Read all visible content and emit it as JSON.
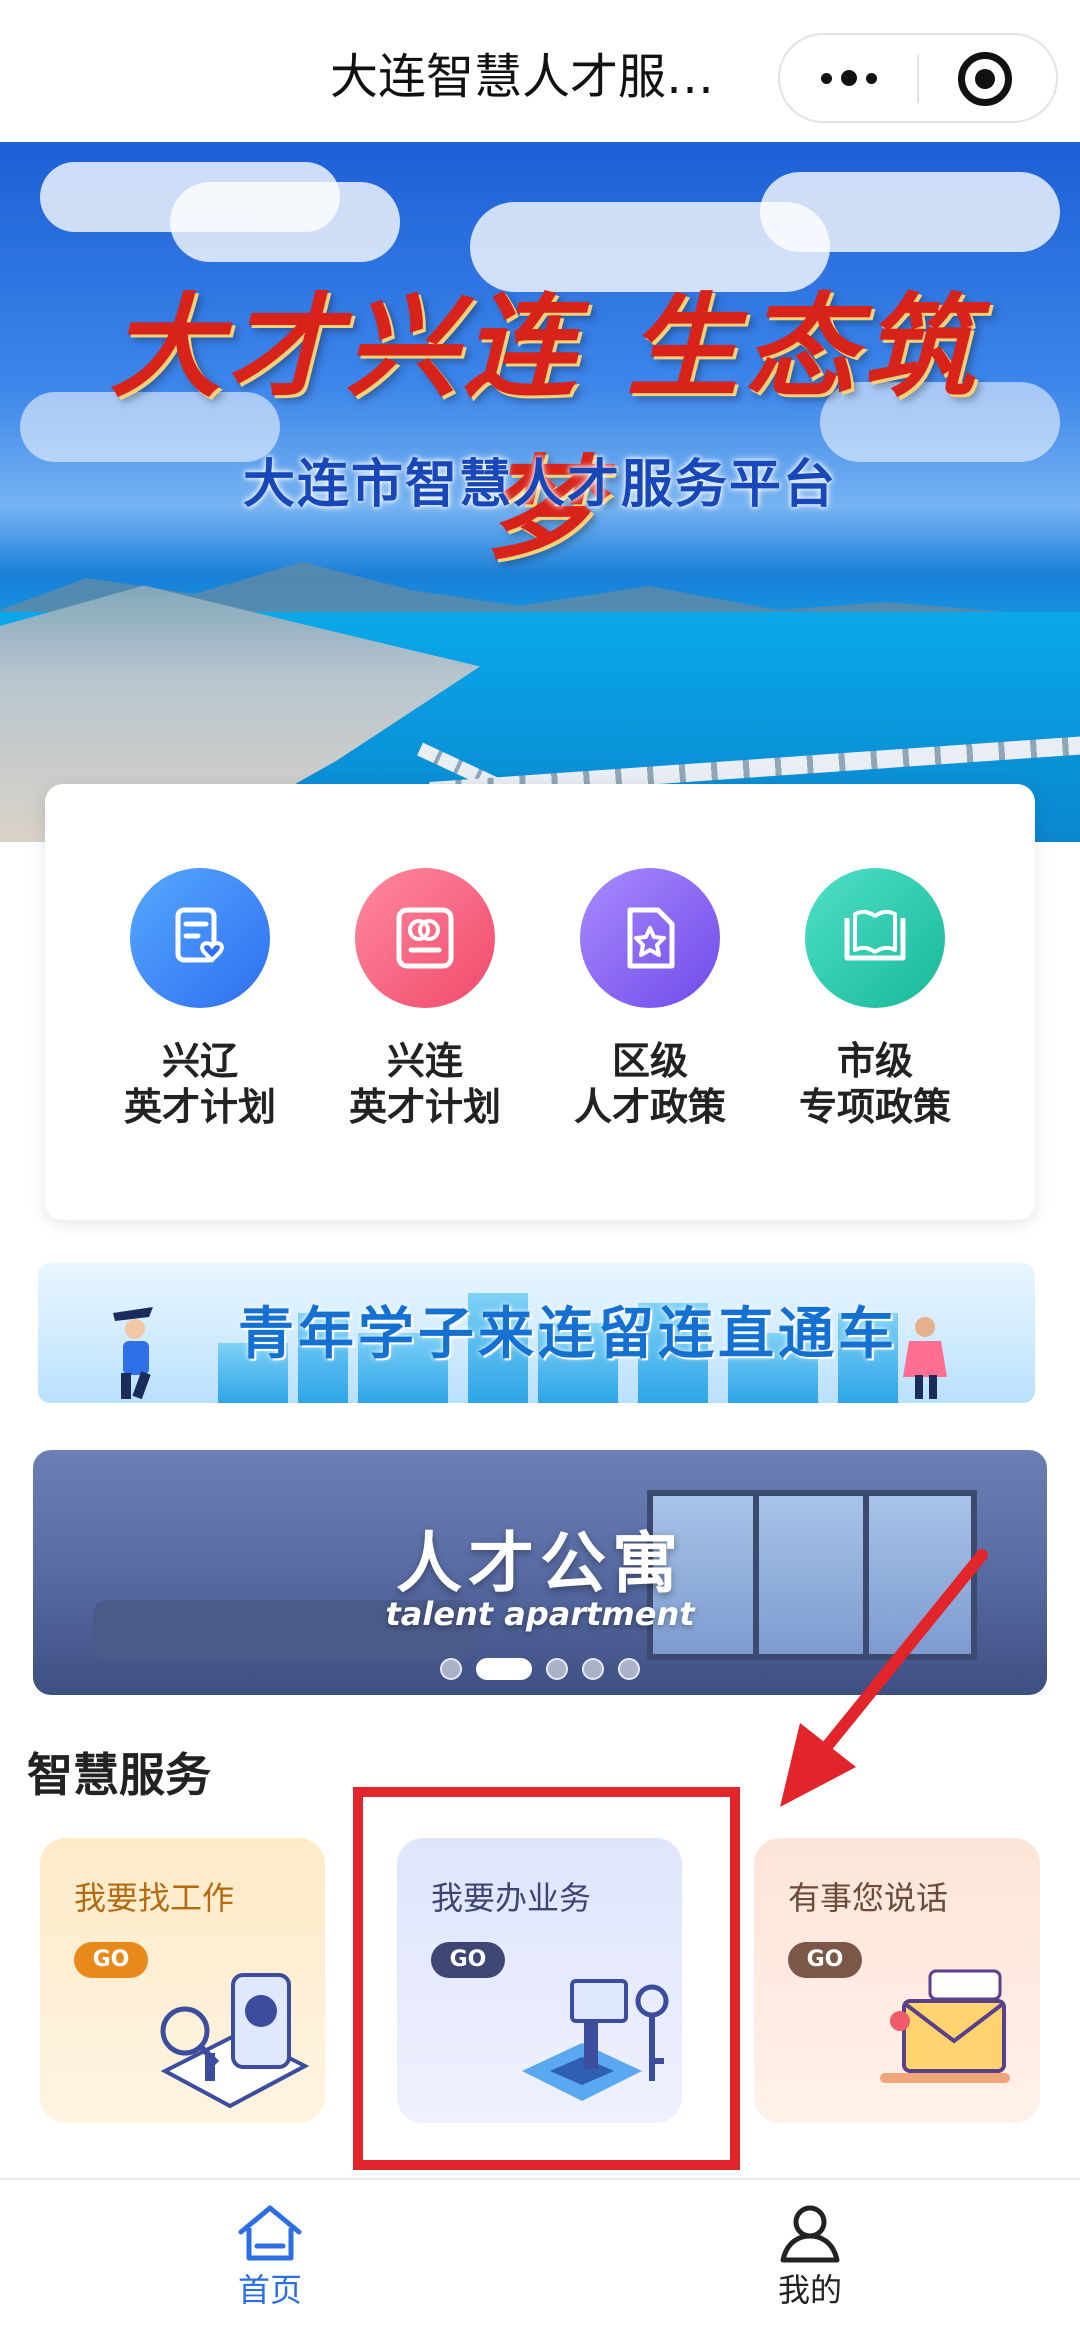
{
  "topbar": {
    "title": "大连智慧人才服…",
    "more_icon": "more-dots-icon",
    "close_icon": "mini-program-target-icon"
  },
  "hero": {
    "slogan": "大才兴连 生态筑梦",
    "platform_name": "大连市智慧人才服务平台"
  },
  "categories": [
    {
      "line1": "兴辽",
      "line2": "英才计划",
      "icon": "document-heart-icon"
    },
    {
      "line1": "兴连",
      "line2": "英才计划",
      "icon": "profile-card-icon"
    },
    {
      "line1": "区级",
      "line2": "人才政策",
      "icon": "document-star-icon"
    },
    {
      "line1": "市级",
      "line2": "专项政策",
      "icon": "book-icon"
    }
  ],
  "youth_banner": {
    "text": "青年学子来连留连直通车"
  },
  "apartment_banner": {
    "title": "人才公寓",
    "subtitle": "talent apartment",
    "page_count": 5,
    "active_page": 2
  },
  "section": {
    "title": "智慧服务"
  },
  "services": [
    {
      "label": "我要找工作",
      "go": "GO"
    },
    {
      "label": "我要办业务",
      "go": "GO"
    },
    {
      "label": "有事您说话",
      "go": "GO"
    }
  ],
  "annotation": {
    "color": "#e2242b"
  },
  "navbar": {
    "home_label": "首页",
    "mine_label": "我的",
    "active_color": "#2b6fe3"
  }
}
